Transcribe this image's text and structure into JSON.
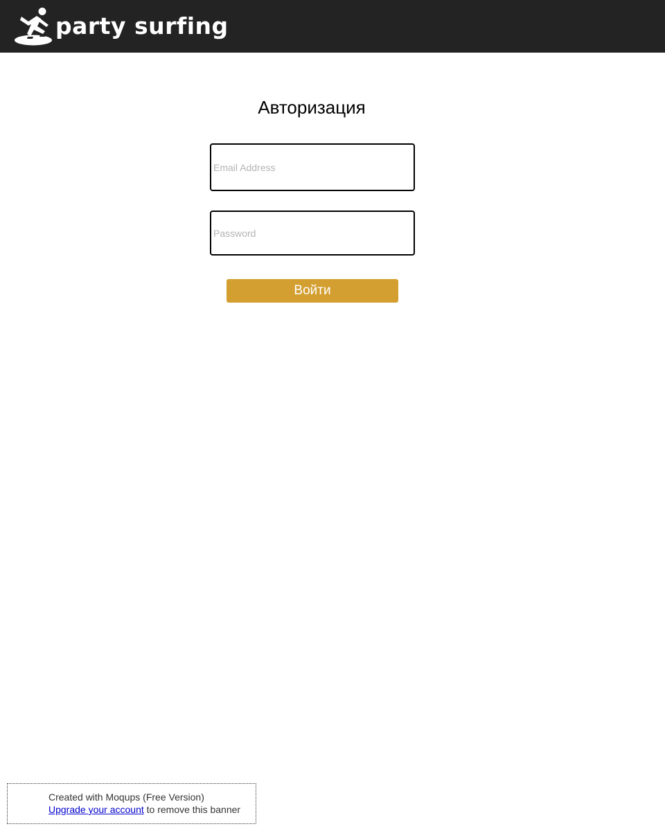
{
  "header": {
    "logo_text": "party surfing",
    "logo_icon": "surfer-icon",
    "background_color": "#232323"
  },
  "login": {
    "title": "Авторизация",
    "email_placeholder": "Email Address",
    "email_value": "",
    "password_placeholder": "Password",
    "password_value": "",
    "submit_label": "Войти",
    "button_color": "#d39f30"
  },
  "banner": {
    "line1": "Created with Moqups (Free Version)",
    "link_text": "Upgrade your account",
    "line2_suffix": " to remove this banner"
  }
}
